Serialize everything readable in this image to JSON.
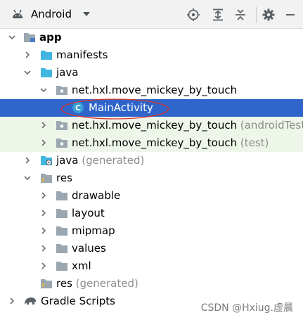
{
  "toolbar": {
    "view_title": "Android",
    "icons": [
      "android-icon",
      "dropdown-caret-icon",
      "locate-icon",
      "expand-all-icon",
      "collapse-all-icon",
      "settings-gear-icon",
      "minimize-icon"
    ]
  },
  "tree": {
    "app": "app",
    "manifests": "manifests",
    "java": "java",
    "pkg_main": "net.hxl.move_mickey_by_touch",
    "main_activity": "MainActivity",
    "pkg_android_test": "net.hxl.move_mickey_by_touch",
    "pkg_android_test_suffix": "(androidTest)",
    "pkg_test": "net.hxl.move_mickey_by_touch",
    "pkg_test_suffix": "(test)",
    "java_generated": "java",
    "java_generated_suffix": "(generated)",
    "res": "res",
    "drawable": "drawable",
    "layout": "layout",
    "mipmap": "mipmap",
    "values": "values",
    "xml": "xml",
    "res_generated": "res",
    "res_generated_suffix": "(generated)",
    "gradle_scripts": "Gradle Scripts"
  },
  "watermark": "CSDN @Hxiug.虚晨",
  "colors": {
    "selection": "#2f65ca",
    "tint_rows": "#eef6ea",
    "folder": "#9aa7b0",
    "java_folder": "#40b6e0",
    "class_badge": "#389fd6",
    "annotation_red": "#d9342b",
    "android_green": "#3ddc84"
  }
}
